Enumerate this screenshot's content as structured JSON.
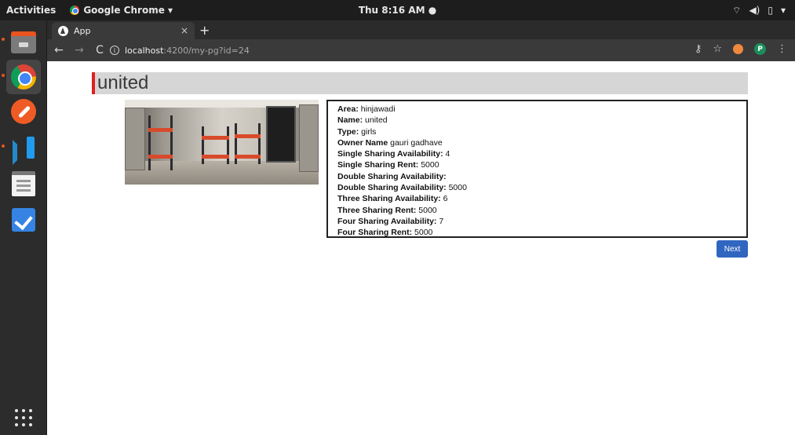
{
  "system_bar": {
    "activities": "Activities",
    "app_name": "Google Chrome ▾",
    "clock": "Thu  8:16 AM ●",
    "tray_icons": [
      "wifi-icon",
      "volume-icon",
      "battery-icon",
      "menu-arrow-icon"
    ]
  },
  "dock": {
    "items": [
      "files-icon",
      "chrome-icon",
      "postman-icon",
      "vscode-icon",
      "text-editor-icon",
      "todo-icon"
    ],
    "show_apps": "show-applications-icon"
  },
  "browser": {
    "tab_title": "App",
    "tab_close": "×",
    "new_tab": "+",
    "url_host": "localhost",
    "url_path": ":4200/my-pg?id=24"
  },
  "page": {
    "title": "united",
    "details": [
      {
        "label": "Area:",
        "value": "hinjawadi"
      },
      {
        "label": "Name:",
        "value": "united"
      },
      {
        "label": "Type:",
        "value": "girls"
      },
      {
        "label": "Owner Name",
        "value": "gauri gadhave"
      },
      {
        "label": "Single Sharing Availability:",
        "value": "4"
      },
      {
        "label": "Single Sharing Rent:",
        "value": "5000"
      },
      {
        "label": "Double Sharing Availability:",
        "value": ""
      },
      {
        "label": "Double Sharing Availability:",
        "value": "5000"
      },
      {
        "label": "Three Sharing Availability:",
        "value": "6"
      },
      {
        "label": "Three Sharing Rent:",
        "value": "5000"
      },
      {
        "label": "Four Sharing Availability:",
        "value": "7"
      },
      {
        "label": "Four Sharing Rent:",
        "value": "5000"
      }
    ],
    "next_label": "Next"
  },
  "colors": {
    "title_accent": "#e21e1e",
    "title_bg": "#d6d6d6",
    "button": "#3066c0"
  }
}
